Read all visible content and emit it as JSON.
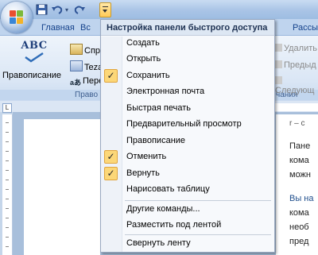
{
  "tabs": [
    "Главная",
    "Вс",
    "Рассы"
  ],
  "ribbon": {
    "spell_label": "Правописание",
    "abc": "ABC",
    "small_cmds": [
      "Спра",
      "Teza",
      "Пере"
    ],
    "group_label_left": "Право",
    "group_label_right": "чания",
    "right_cmds": [
      "Удалить",
      "Предыд",
      "Следующ"
    ]
  },
  "menu": {
    "title": "Настройка панели быстрого доступа",
    "items": [
      {
        "label": "Создать",
        "checked": false
      },
      {
        "label": "Открыть",
        "checked": false
      },
      {
        "label": "Сохранить",
        "checked": true
      },
      {
        "label": "Электронная почта",
        "checked": false
      },
      {
        "label": "Быстрая печать",
        "checked": false
      },
      {
        "label": "Предварительный просмотр",
        "checked": false
      },
      {
        "label": "Правописание",
        "checked": false
      },
      {
        "label": "Отменить",
        "checked": true
      },
      {
        "label": "Вернуть",
        "checked": true
      },
      {
        "label": "Нарисовать таблицу",
        "checked": false
      }
    ],
    "more_commands": "Другие команды...",
    "below_ribbon": "Разместить под лентой",
    "minimize_ribbon": "Свернуть ленту"
  },
  "document": {
    "lines": [
      "Пане",
      "кома",
      "можн",
      "Вы на",
      "кома",
      "необ",
      "пред"
    ],
    "heading_fragment": "r – с"
  },
  "colors": {
    "check_bg": "#fcd778",
    "tab_text": "#15428b"
  }
}
